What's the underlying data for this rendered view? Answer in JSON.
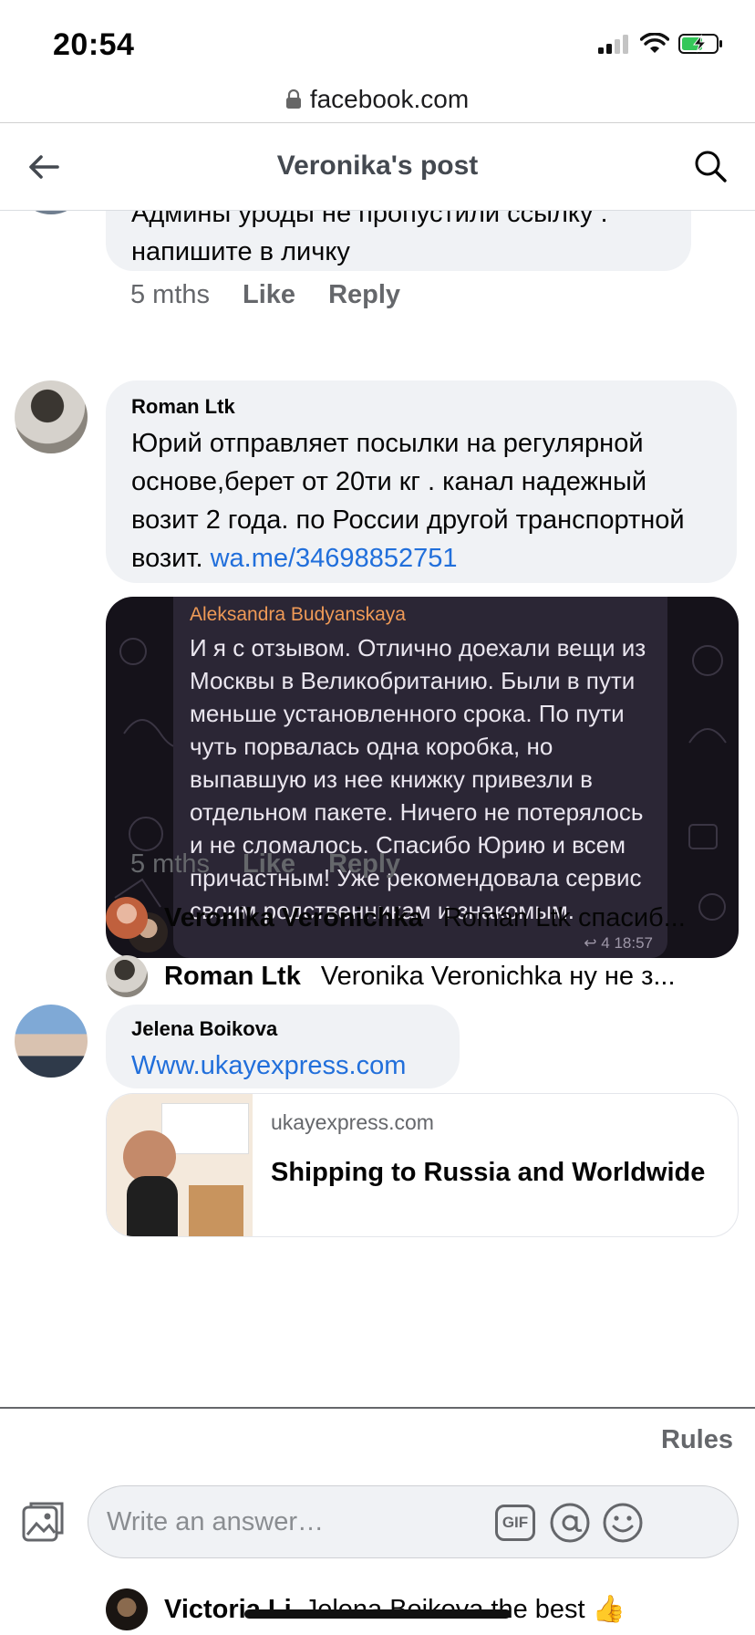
{
  "status_bar": {
    "time": "20:54"
  },
  "browser": {
    "url": "facebook.com"
  },
  "header": {
    "title": "Veronika's post"
  },
  "comments": [
    {
      "text": "Админы уроды не пропустили ссылку . напишите в личку",
      "time": "5 mths",
      "like": "Like",
      "reply": "Reply"
    },
    {
      "author": "Roman Ltk",
      "text": "Юрий отправляет посылки на регулярной основе,берет от 20ти кг . канал надежный возит 2 года. по России другой транспортной возит.",
      "link": "wa.me/34698852751",
      "image": {
        "sender": "Aleksandra Budyanskaya",
        "message": "И я с отзывом. Отлично доехали вещи из Москвы в Великобританию. Были в пути меньше установленного срока. По пути чуть порвалась одна коробка, но выпавшую из нее книжку привезли в отдельном пакете. Ничего не потерялось и не сломалось. Спасибо Юрию и всем причастным! Уже рекомендовала сервис своим родственникам и знакомым.",
        "meta": "4  18:57"
      },
      "time": "5 mths",
      "like": "Like",
      "reply": "Reply",
      "replies": [
        {
          "author": "Veronika Veronichka",
          "text": "Roman Ltk спасиб..."
        },
        {
          "author": "Roman Ltk",
          "text": "Veronika Veronichka ну не з..."
        }
      ]
    },
    {
      "author": "Jelena Boikova",
      "link": "Www.ukayexpress.com",
      "preview": {
        "domain": "ukayexpress.com",
        "title": "Shipping to Russia and Worldwide"
      }
    }
  ],
  "footer": {
    "rules": "Rules",
    "placeholder": "Write an answer…",
    "gif": "GIF"
  },
  "peek_reply": {
    "author": "Victoria Li",
    "text": "Jelena Boikova the best 👍"
  }
}
